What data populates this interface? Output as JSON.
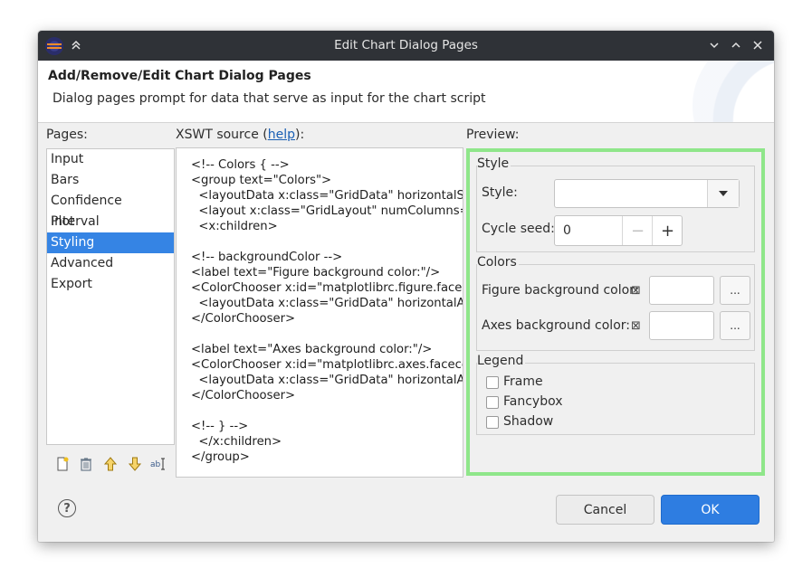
{
  "window": {
    "title": "Edit Chart Dialog Pages"
  },
  "titlebar_icons": [
    "app-icon",
    "chevrons-up-icon",
    "chevron-down-icon",
    "chevron-up-icon",
    "close-icon"
  ],
  "header": {
    "title": "Add/Remove/Edit Chart Dialog Pages",
    "description": "Dialog pages prompt for data that serve as input for the chart script"
  },
  "pages": {
    "label": "Pages:",
    "items": [
      {
        "label": "Input"
      },
      {
        "label": "Bars"
      },
      {
        "label": "Confidence Interval"
      },
      {
        "label": "Plot"
      },
      {
        "label": "Styling",
        "selected": true
      },
      {
        "label": "Advanced"
      },
      {
        "label": "Export"
      }
    ],
    "tools": [
      "new-page-icon",
      "delete-icon",
      "move-up-icon",
      "move-down-icon",
      "rename-icon"
    ]
  },
  "source": {
    "label_prefix": "XSWT source (",
    "label_link": "help",
    "label_suffix": "):",
    "text": "<!-- Colors { -->\n<group text=\"Colors\">\n  <layoutData x:class=\"GridData\" horizontalSpan=\"2\"/>\n  <layout x:class=\"GridLayout\" numColumns=\"2\"/>\n  <x:children>\n\n<!-- backgroundColor -->\n<label text=\"Figure background color:\"/>\n<ColorChooser x:id=\"matplotlibrc.figure.facecolor\"\n  <layoutData x:class=\"GridData\" horizontalAlignment=\"FILL\"/>\n</ColorChooser>\n\n<label text=\"Axes background color:\"/>\n<ColorChooser x:id=\"matplotlibrc.axes.facecolor\"\n  <layoutData x:class=\"GridData\" horizontalAlignment=\"FILL\"/>\n</ColorChooser>\n\n<!-- } -->\n  </x:children>\n</group>"
  },
  "preview": {
    "label": "Preview:",
    "style_group": {
      "title": "Style",
      "style_label": "Style:",
      "style_value": "",
      "cycle_seed_label": "Cycle seed:",
      "cycle_seed_value": "0",
      "minus": "−",
      "plus": "+"
    },
    "colors_group": {
      "title": "Colors",
      "figure_label": "Figure background color:",
      "axes_label": "Axes background color:",
      "mark": "⊠",
      "browse": "..."
    },
    "legend_group": {
      "title": "Legend",
      "options": [
        {
          "label": "Frame",
          "checked": false
        },
        {
          "label": "Fancybox",
          "checked": false
        },
        {
          "label": "Shadow",
          "checked": false
        }
      ]
    },
    "highlight_color": "#8fe68a"
  },
  "footer": {
    "help": "?",
    "cancel": "Cancel",
    "ok": "OK"
  },
  "colors": {
    "accent": "#3584e4",
    "titlebar": "#2f3237",
    "link": "#1a5fb4"
  }
}
